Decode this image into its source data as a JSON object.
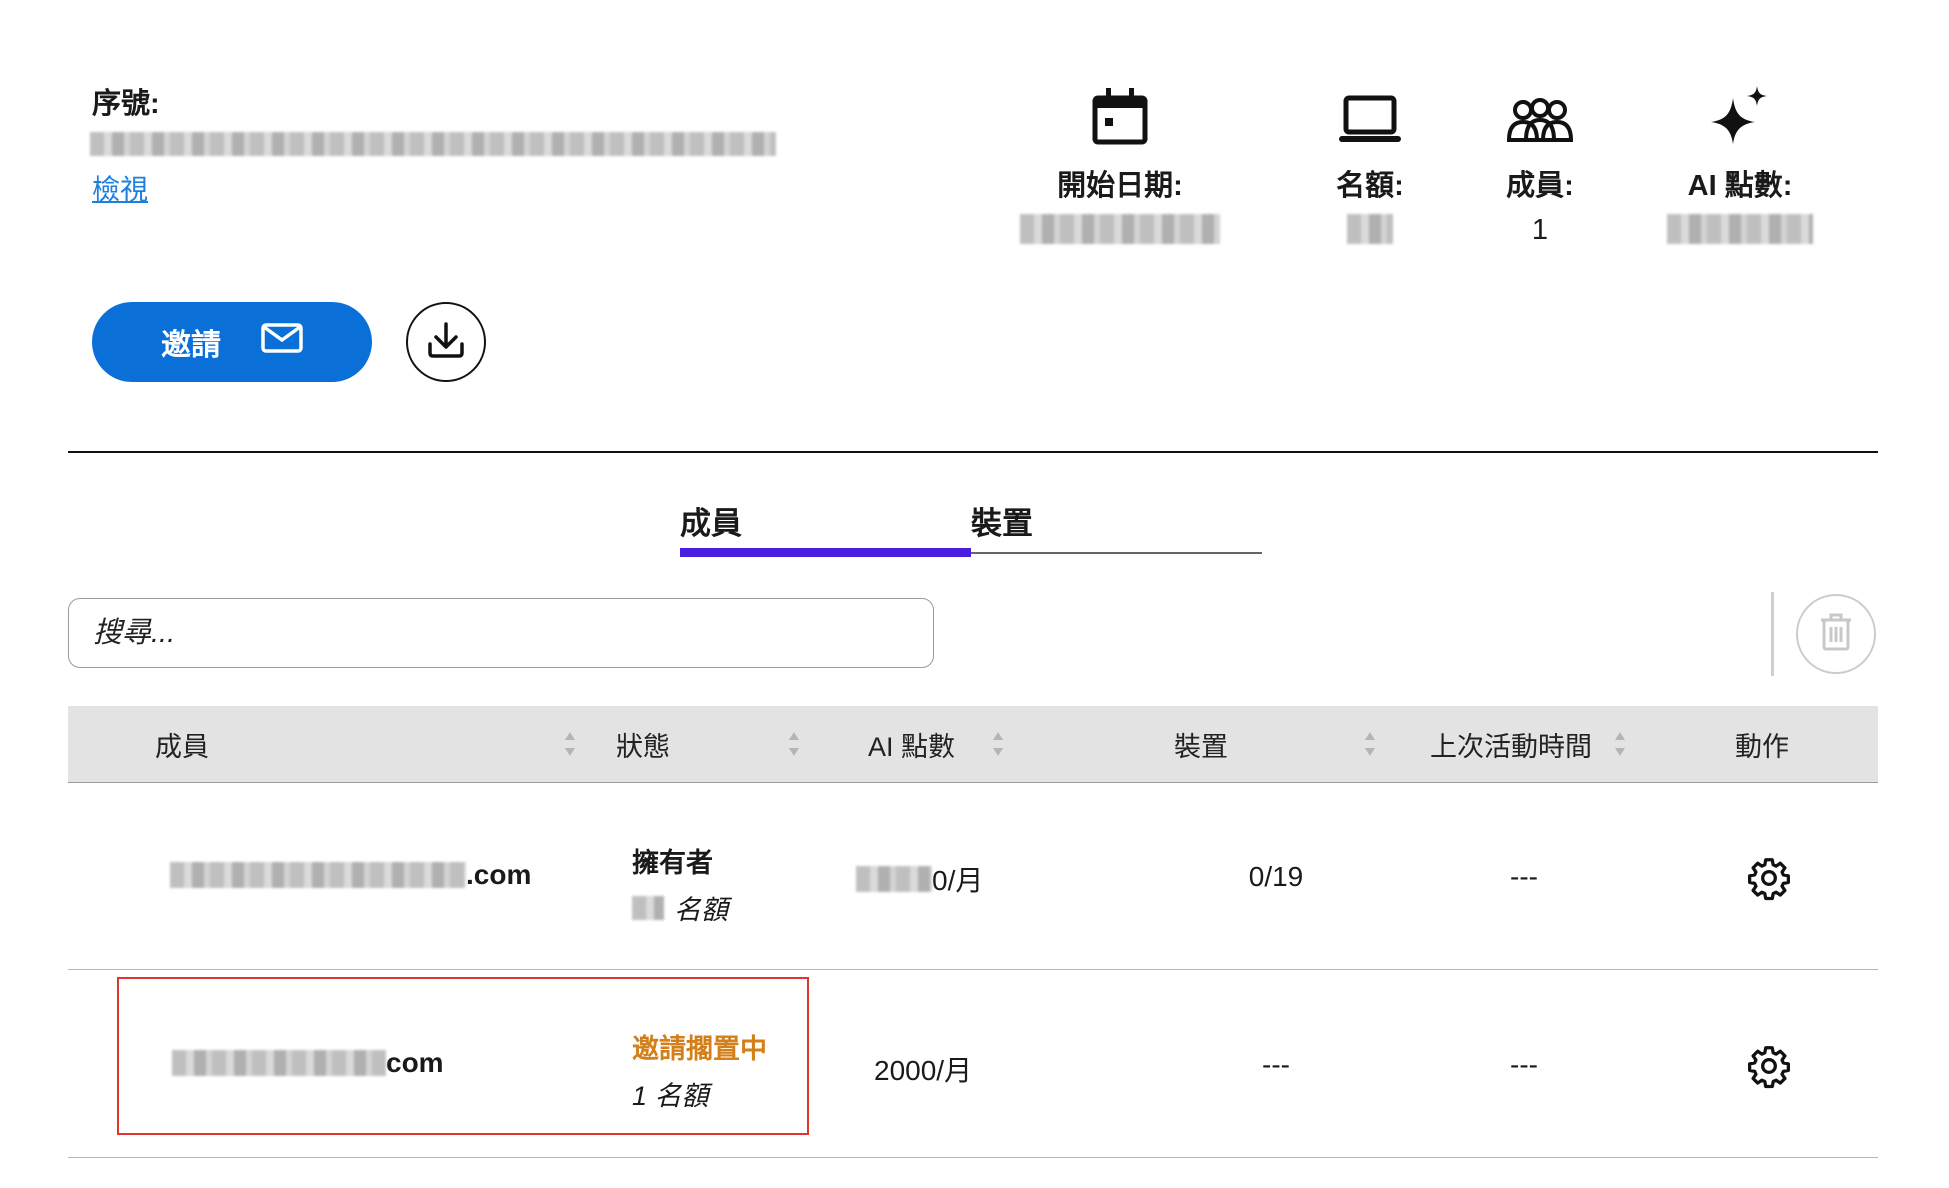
{
  "header": {
    "serial_label": "序號:",
    "view_link": "檢視"
  },
  "stats": [
    {
      "icon": "calendar-icon",
      "label": "開始日期:",
      "value": ""
    },
    {
      "icon": "laptop-icon",
      "label": "名額:",
      "value": ""
    },
    {
      "icon": "users-icon",
      "label": "成員:",
      "value": "1"
    },
    {
      "icon": "sparkle-icon",
      "label": "AI 點數:",
      "value": ""
    }
  ],
  "actions": {
    "invite_label": "邀請",
    "invite_icon": "envelope-icon",
    "download_icon": "download-icon"
  },
  "tabs": [
    {
      "label": "成員",
      "active": true
    },
    {
      "label": "裝置",
      "active": false
    }
  ],
  "search": {
    "placeholder": "搜尋..."
  },
  "table": {
    "columns": [
      "成員",
      "狀態",
      "AI 點數",
      "裝置",
      "上次活動時間",
      "動作"
    ],
    "rows": [
      {
        "email_suffix": ".com",
        "status": "擁有者",
        "status_sub": "名額",
        "ai_points": "0/月",
        "devices": "0/19",
        "last_active": "---"
      },
      {
        "email_suffix": "com",
        "status": "邀請擱置中",
        "status_sub": "1 名額",
        "ai_points": "2000/月",
        "devices": "---",
        "last_active": "---"
      }
    ]
  },
  "colors": {
    "primary": "#0b6fd8",
    "tab_active": "#4a1ee0",
    "pending_status": "#d4801a",
    "link": "#1a7fe0",
    "highlight": "#e0342f"
  }
}
